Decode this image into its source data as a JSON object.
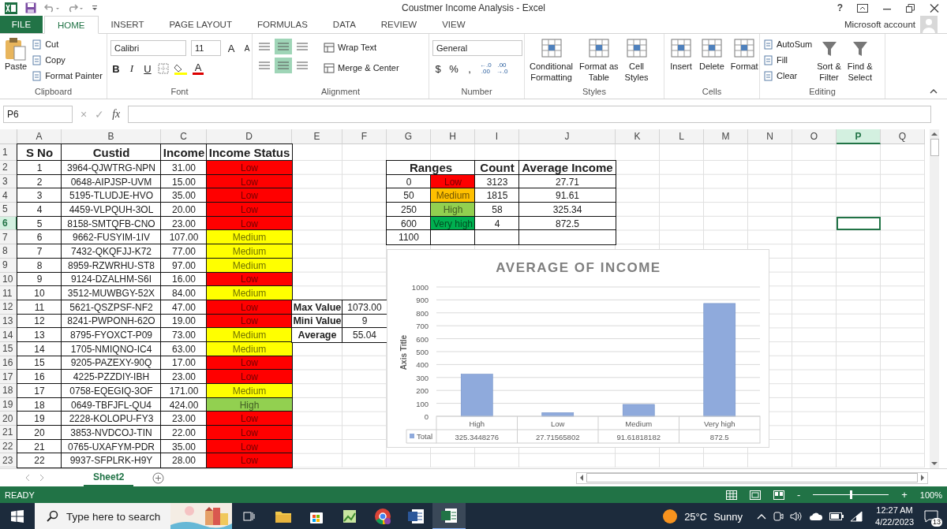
{
  "title_bar": {
    "title": "Coustmer Income Analysis - Excel",
    "help": "?"
  },
  "tabs": [
    {
      "label": "FILE",
      "kind": "file",
      "selected": false
    },
    {
      "label": "HOME",
      "kind": "tab",
      "selected": true
    },
    {
      "label": "INSERT",
      "kind": "tab",
      "selected": false
    },
    {
      "label": "PAGE LAYOUT",
      "kind": "tab",
      "selected": false
    },
    {
      "label": "FORMULAS",
      "kind": "tab",
      "selected": false
    },
    {
      "label": "DATA",
      "kind": "tab",
      "selected": false
    },
    {
      "label": "REVIEW",
      "kind": "tab",
      "selected": false
    },
    {
      "label": "VIEW",
      "kind": "tab",
      "selected": false
    }
  ],
  "account": "Microsoft account",
  "ribbon": [
    {
      "kind": "clipboard",
      "label": "Clipboard",
      "large": {
        "label": "Paste"
      },
      "small": [
        {
          "label": "Cut"
        },
        {
          "label": "Copy"
        },
        {
          "label": "Format Painter"
        }
      ]
    },
    {
      "kind": "font",
      "label": "Font",
      "font_name": "Calibri",
      "font_size": "11",
      "grow": "A",
      "shrink": "A",
      "styles": [
        "B",
        "I",
        "U"
      ],
      "font_color": "A"
    },
    {
      "kind": "alignment",
      "label": "Alignment",
      "align": [
        {
          "selected": false
        },
        {
          "selected": true
        },
        {
          "selected": false
        },
        {
          "selected": false
        },
        {
          "selected": true
        },
        {
          "selected": false
        }
      ],
      "commands": [
        {
          "label": "Wrap Text"
        },
        {
          "label": "Merge & Center"
        }
      ]
    },
    {
      "kind": "number",
      "label": "Number",
      "format": "General",
      "symbols": [
        "$",
        "%",
        ","
      ],
      "decimals": [
        {
          "top": "←.0",
          "bottom": ".00"
        },
        {
          "top": ".00",
          "bottom": "→.0"
        }
      ]
    },
    {
      "kind": "large",
      "label": "Styles",
      "commands": [
        {
          "label": "Conditional\nFormatting"
        },
        {
          "label": "Format as\nTable"
        },
        {
          "label": "Cell\nStyles"
        }
      ]
    },
    {
      "kind": "large",
      "label": "Cells",
      "commands": [
        {
          "label": "Insert"
        },
        {
          "label": "Delete"
        },
        {
          "label": "Format"
        }
      ]
    },
    {
      "kind": "editing",
      "label": "Editing",
      "small": [
        {
          "label": "AutoSum"
        },
        {
          "label": "Fill"
        },
        {
          "label": "Clear"
        }
      ],
      "large": [
        {
          "label": "Sort &\nFilter"
        },
        {
          "label": "Find &\nSelect"
        }
      ]
    }
  ],
  "formula_bar": {
    "name_box": "P6",
    "cancel": "×",
    "enter": "✓",
    "function": "fx"
  },
  "sheet": {
    "columns": [
      {
        "label": "A",
        "selected": false
      },
      {
        "label": "B",
        "selected": false
      },
      {
        "label": "C",
        "selected": false
      },
      {
        "label": "D",
        "selected": false
      },
      {
        "label": "E",
        "selected": false
      },
      {
        "label": "F",
        "selected": false
      },
      {
        "label": "G",
        "selected": false
      },
      {
        "label": "H",
        "selected": false
      },
      {
        "label": "I",
        "selected": false
      },
      {
        "label": "J",
        "selected": false
      },
      {
        "label": "K",
        "selected": false
      },
      {
        "label": "L",
        "selected": false
      },
      {
        "label": "M",
        "selected": false
      },
      {
        "label": "N",
        "selected": false
      },
      {
        "label": "O",
        "selected": false
      },
      {
        "label": "P",
        "selected": true
      },
      {
        "label": "Q",
        "selected": false
      }
    ],
    "rows": [
      {
        "label": "1",
        "selected": false
      },
      {
        "label": "2",
        "selected": false
      },
      {
        "label": "3",
        "selected": false
      },
      {
        "label": "4",
        "selected": false
      },
      {
        "label": "5",
        "selected": false
      },
      {
        "label": "6",
        "selected": true
      },
      {
        "label": "7",
        "selected": false
      },
      {
        "label": "8",
        "selected": false
      },
      {
        "label": "9",
        "selected": false
      },
      {
        "label": "10",
        "selected": false
      },
      {
        "label": "11",
        "selected": false
      },
      {
        "label": "12",
        "selected": false
      },
      {
        "label": "13",
        "selected": false
      },
      {
        "label": "14",
        "selected": false
      },
      {
        "label": "15",
        "selected": false
      },
      {
        "label": "16",
        "selected": false
      },
      {
        "label": "17",
        "selected": false
      },
      {
        "label": "18",
        "selected": false
      },
      {
        "label": "19",
        "selected": false
      },
      {
        "label": "20",
        "selected": false
      },
      {
        "label": "21",
        "selected": false
      },
      {
        "label": "22",
        "selected": false
      },
      {
        "label": "23",
        "selected": false
      }
    ],
    "customers": {
      "columns": [
        "S No",
        "Custid",
        "Income",
        "Income Status"
      ],
      "rows": [
        {
          "s_no": "1",
          "custid": "3964-QJWTRG-NPN",
          "income": "31.00",
          "status": "Low",
          "color": "#ff0000"
        },
        {
          "s_no": "2",
          "custid": "0648-AIPJSP-UVM",
          "income": "15.00",
          "status": "Low",
          "color": "#ff0000"
        },
        {
          "s_no": "3",
          "custid": "5195-TLUDJE-HVO",
          "income": "35.00",
          "status": "Low",
          "color": "#ff0000"
        },
        {
          "s_no": "4",
          "custid": "4459-VLPQUH-3OL",
          "income": "20.00",
          "status": "Low",
          "color": "#ff0000"
        },
        {
          "s_no": "5",
          "custid": "8158-SMTQFB-CNO",
          "income": "23.00",
          "status": "Low",
          "color": "#ff0000"
        },
        {
          "s_no": "6",
          "custid": "9662-FUSYIM-1IV",
          "income": "107.00",
          "status": "Medium",
          "color": "#ffff00"
        },
        {
          "s_no": "7",
          "custid": "7432-QKQFJJ-K72",
          "income": "77.00",
          "status": "Medium",
          "color": "#ffff00"
        },
        {
          "s_no": "8",
          "custid": "8959-RZWRHU-ST8",
          "income": "97.00",
          "status": "Medium",
          "color": "#ffff00"
        },
        {
          "s_no": "9",
          "custid": "9124-DZALHM-S6I",
          "income": "16.00",
          "status": "Low",
          "color": "#ff0000"
        },
        {
          "s_no": "10",
          "custid": "3512-MUWBGY-52X",
          "income": "84.00",
          "status": "Medium",
          "color": "#ffff00"
        },
        {
          "s_no": "11",
          "custid": "5621-QSZPSF-NF2",
          "income": "47.00",
          "status": "Low",
          "color": "#ff0000"
        },
        {
          "s_no": "12",
          "custid": "8241-PWPONH-62O",
          "income": "19.00",
          "status": "Low",
          "color": "#ff0000"
        },
        {
          "s_no": "13",
          "custid": "8795-FYOXCT-P09",
          "income": "73.00",
          "status": "Medium",
          "color": "#ffff00"
        },
        {
          "s_no": "14",
          "custid": "1705-NMIQNO-IC4",
          "income": "63.00",
          "status": "Medium",
          "color": "#ffff00"
        },
        {
          "s_no": "15",
          "custid": "9205-PAZEXY-90Q",
          "income": "17.00",
          "status": "Low",
          "color": "#ff0000"
        },
        {
          "s_no": "16",
          "custid": "4225-PZZDIY-IBH",
          "income": "23.00",
          "status": "Low",
          "color": "#ff0000"
        },
        {
          "s_no": "17",
          "custid": "0758-EQEGIQ-3OF",
          "income": "171.00",
          "status": "Medium",
          "color": "#ffff00"
        },
        {
          "s_no": "18",
          "custid": "0649-TBFJFL-QU4",
          "income": "424.00",
          "status": "High",
          "color": "#92d050"
        },
        {
          "s_no": "19",
          "custid": "2228-KOLOPU-FY3",
          "income": "23.00",
          "status": "Low",
          "color": "#ff0000"
        },
        {
          "s_no": "20",
          "custid": "3853-NVDCOJ-TIN",
          "income": "22.00",
          "status": "Low",
          "color": "#ff0000"
        },
        {
          "s_no": "21",
          "custid": "0765-UXAFYM-PDR",
          "income": "35.00",
          "status": "Low",
          "color": "#ff0000"
        },
        {
          "s_no": "22",
          "custid": "9937-SFPLRK-H9Y",
          "income": "28.00",
          "status": "Low",
          "color": "#ff0000"
        }
      ]
    },
    "ranges": {
      "columns": [
        "Ranges",
        "Count",
        "Average Income"
      ],
      "rows": [
        {
          "from": "0",
          "label": "Low",
          "color": "#ff0000",
          "count": "3123",
          "average": "27.71"
        },
        {
          "from": "50",
          "label": "Medium",
          "color": "#ffc000",
          "count": "1815",
          "average": "91.61"
        },
        {
          "from": "250",
          "label": "High",
          "color": "#92d050",
          "count": "58",
          "average": "325.34"
        },
        {
          "from": "600",
          "label": "Very high",
          "color": "#00b050",
          "count": "4",
          "average": "872.5"
        },
        {
          "from": "1100"
        }
      ]
    },
    "summary": [
      {
        "label": "Max Value",
        "value": "1073.00"
      },
      {
        "label": "Mini Value",
        "value": "9"
      },
      {
        "label": "Average",
        "value": "55.04"
      }
    ],
    "chart": {
      "chart_data": {
        "type": "bar",
        "title": "AVERAGE OF INCOME",
        "ylabel": "Axis Title",
        "categories": [
          "High",
          "Low",
          "Medium",
          "Very high"
        ],
        "series": [
          {
            "name": "Total",
            "color": "#8faadc",
            "values": [
              325.3,
              27.7,
              91.6,
              872.5
            ]
          }
        ],
        "grid": true,
        "ylim": [
          0,
          1000
        ],
        "yticks": [
          0,
          100,
          200,
          300,
          400,
          500,
          600,
          700,
          800,
          900,
          1000
        ],
        "value_labels": [
          "325.3448276",
          "27.71565802",
          "91.61818182",
          "872.5"
        ]
      }
    }
  },
  "sheet_tabs": [
    {
      "label": "Sheet2",
      "selected": true
    }
  ],
  "status_bar": {
    "status": "READY",
    "zoom_out": "-",
    "zoom_in": "+",
    "zoom": "100%",
    "zoom_slider": {
      "level": 0.5
    }
  },
  "taskbar": {
    "search_placeholder": "Type here to search",
    "temperature": "25°C",
    "condition": "Sunny",
    "time": "12:27 AM",
    "date": "4/22/2023",
    "notifications": "13"
  }
}
